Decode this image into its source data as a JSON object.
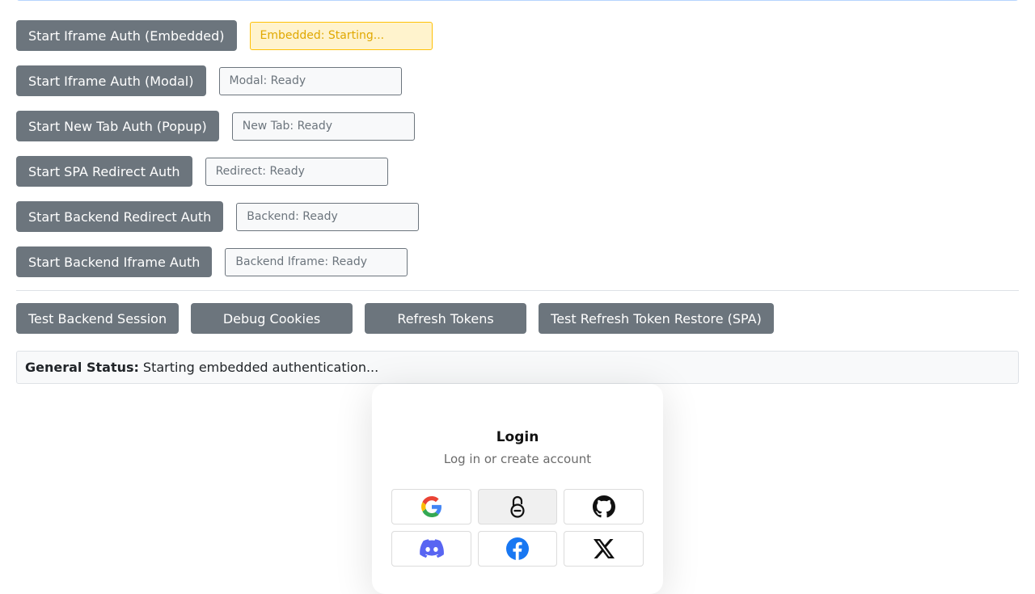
{
  "auth_rows": [
    {
      "button": "Start Iframe Auth (Embedded)",
      "status": "Embedded: Starting..."
    },
    {
      "button": "Start Iframe Auth (Modal)",
      "status": "Modal: Ready"
    },
    {
      "button": "Start New Tab Auth (Popup)",
      "status": "New Tab: Ready"
    },
    {
      "button": "Start SPA Redirect Auth",
      "status": "Redirect: Ready"
    },
    {
      "button": "Start Backend Redirect Auth",
      "status": "Backend: Ready"
    },
    {
      "button": "Start Backend Iframe Auth",
      "status": "Backend Iframe: Ready"
    }
  ],
  "actions": {
    "test_session": "Test Backend Session",
    "debug_cookies": "Debug Cookies",
    "refresh_tokens": "Refresh Tokens",
    "test_restore": "Test Refresh Token Restore (SPA)"
  },
  "general_status": {
    "label": "General Status:",
    "text": "Starting embedded authentication..."
  },
  "login": {
    "title": "Login",
    "subtitle": "Log in or create account",
    "providers": [
      "google-icon",
      "passkey-lock-icon",
      "github-icon",
      "discord-icon",
      "facebook-icon",
      "x-icon"
    ]
  },
  "colors": {
    "button_bg": "#6c757d",
    "warning_bg": "#fff3cd",
    "warning_border": "#ffc107",
    "warning_text": "#e0a800",
    "discord": "#5865F2",
    "facebook": "#1877F2"
  }
}
